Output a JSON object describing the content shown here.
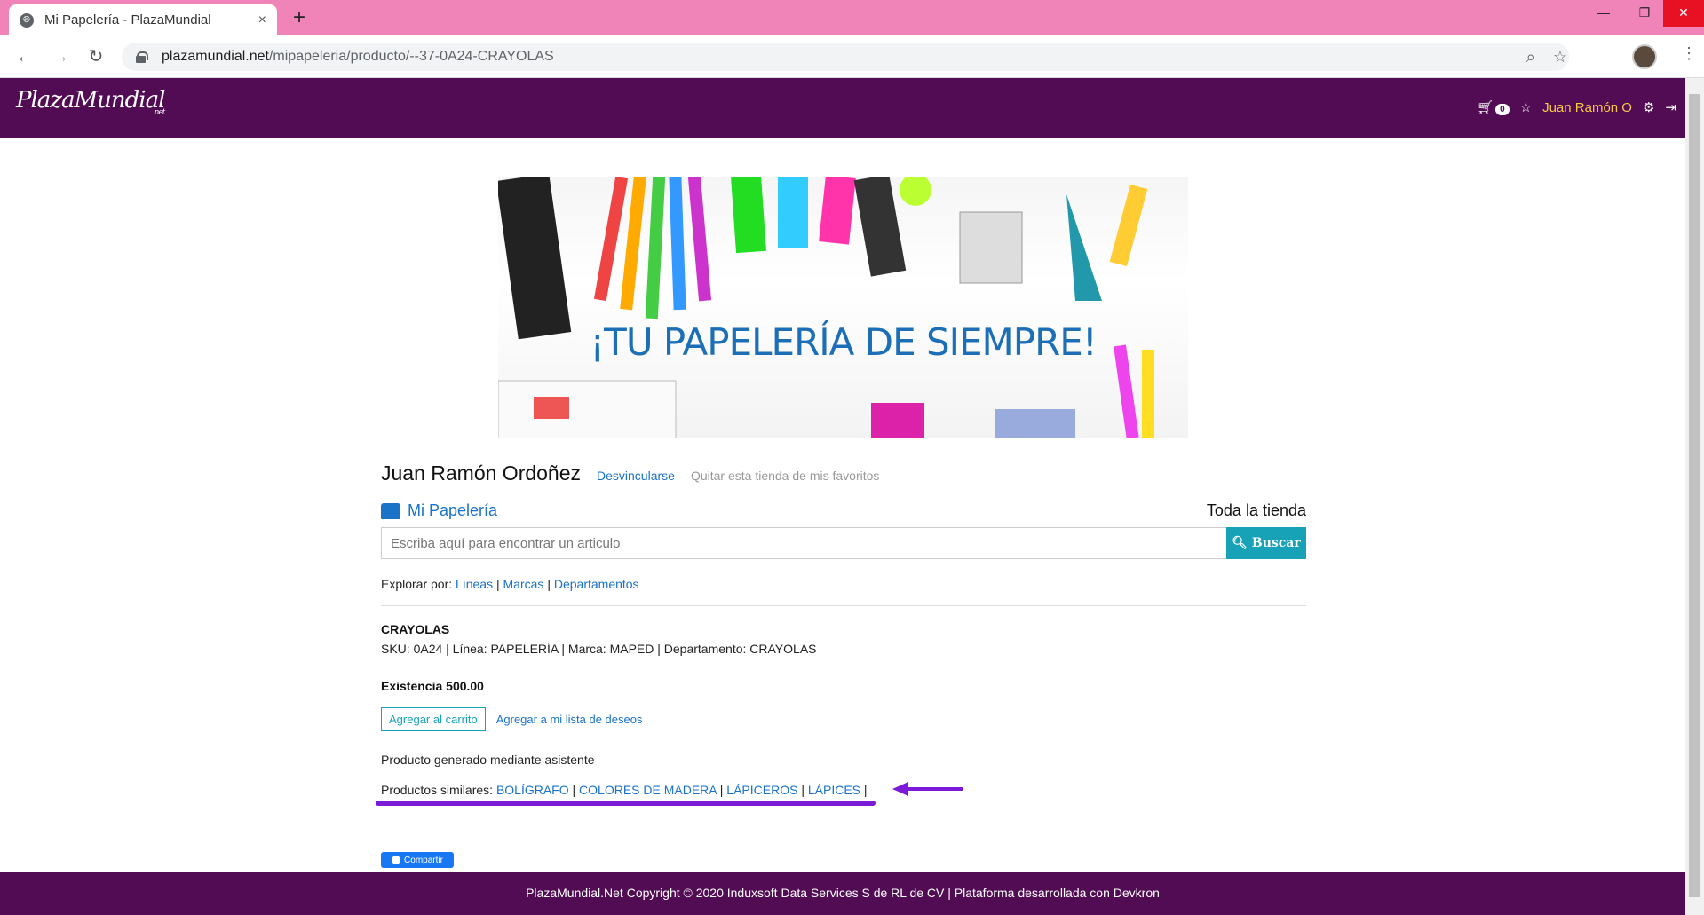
{
  "browser": {
    "tab_title": "Mi Papelería - PlazaMundial",
    "tab_close": "×",
    "new_tab": "+",
    "url_host": "plazamundial.net",
    "url_path": "/mipapeleria/producto/--37-0A24-CRAYOLAS",
    "window_controls": {
      "minimize": "—",
      "maximize": "❐",
      "close": "✕"
    },
    "nav": {
      "back": "←",
      "forward": "→",
      "reload": "↻"
    }
  },
  "site": {
    "logo_text": "PlazaMundial",
    "logo_sub": ".net",
    "cart_count": "0",
    "user_name": "Juan Ramón O"
  },
  "banner": {
    "text": "¡TU PAPELERÍA DE SIEMPRE!"
  },
  "store": {
    "owner": "Juan Ramón Ordoñez",
    "unlink": "Desvincularse",
    "remove_fav": "Quitar esta tienda de mis favoritos",
    "name": "Mi Papelería",
    "whole_store": "Toda la tienda",
    "search_placeholder": "Escriba aquí para encontrar un articulo",
    "search_button": "Buscar"
  },
  "explore": {
    "label": "Explorar por:",
    "links": [
      "Líneas",
      "Marcas",
      "Departamentos"
    ],
    "sep": "|"
  },
  "product": {
    "name": "CRAYOLAS",
    "meta": "SKU: 0A24 | Línea: PAPELERÍA | Marca: MAPED | Departamento: CRAYOLAS",
    "stock": "Existencia 500.00",
    "add_cart": "Agregar al carrito",
    "add_wishlist": "Agregar a mi lista de deseos",
    "generated": "Producto generado mediante asistente",
    "similar_label": "Productos similares:",
    "similar": [
      "BOLÍGRAFO",
      "COLORES DE MADERA",
      "LÁPICEROS",
      "LÁPICES"
    ],
    "similar_sep": "|"
  },
  "share": {
    "label": "Compartir"
  },
  "footer": {
    "text": "PlazaMundial.Net Copyright © 2020 Induxsoft Data Services S de RL de CV | Plataforma desarrollada con Devkron"
  },
  "colors": {
    "header": "#520c54",
    "tabbar": "#f083b8",
    "link": "#1a73c9",
    "accent": "#17a2b8",
    "annotation": "#7b1bd8"
  }
}
